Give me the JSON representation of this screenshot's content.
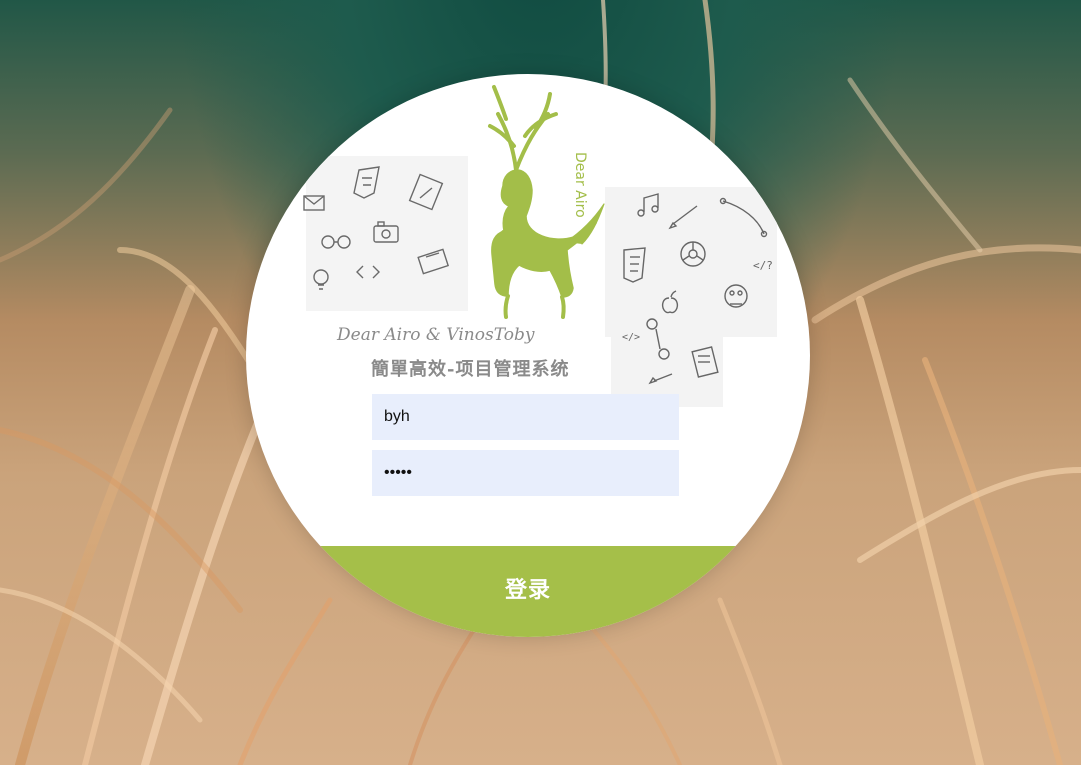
{
  "branding": {
    "logo_text": "Dear Airo",
    "credit_text": "Dear Airo & VinosToby",
    "subtitle": "簡單高效-项目管理系统"
  },
  "form": {
    "username": "byh",
    "password": "12345",
    "login_label": "登录"
  },
  "colors": {
    "accent": "#a5bf49",
    "input_background": "#e8eefc"
  },
  "icons": [
    "mail-icon",
    "css3-icon",
    "tablet-icon",
    "glasses-icon",
    "camera-icon",
    "code-icon",
    "bulb-icon",
    "device-icon",
    "music-icon",
    "pencil-icon",
    "bezier-icon",
    "html5-icon",
    "chrome-icon",
    "apple-icon",
    "mushroom-icon",
    "close-tag-icon",
    "deer-logo-icon"
  ]
}
